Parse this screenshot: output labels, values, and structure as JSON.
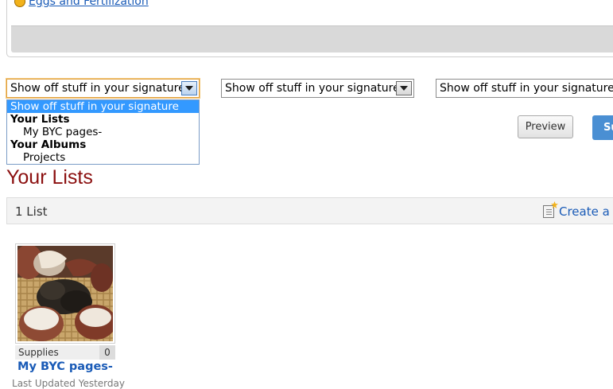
{
  "top_panel": {
    "link_text": " Eggs and Fertilization"
  },
  "signature_selects": [
    {
      "value": "Show off stuff in your signature"
    },
    {
      "value": "Show off stuff in your signature"
    },
    {
      "value": "Show off stuff in your signature"
    }
  ],
  "dropdown": {
    "options": [
      {
        "label": "Show off stuff in your signature"
      },
      {
        "label": "Your Lists"
      },
      {
        "label": "My BYC pages-"
      },
      {
        "label": "Your Albums"
      },
      {
        "label": "Projects"
      }
    ]
  },
  "buttons": {
    "preview": "Preview",
    "submit": "Su"
  },
  "section": {
    "title": "Your Lists"
  },
  "list_bar": {
    "count": "1 List",
    "create_link": "Create a"
  },
  "list_card": {
    "category": "Supplies",
    "count": "0",
    "title": "My BYC pages-",
    "updated": "Last Updated Yesterday"
  },
  "colors": {
    "link": "#1a5bb7",
    "heading": "#8b0f0f",
    "selected_option": "#3399ff",
    "submit_button": "#4a8fd3"
  },
  "icons": [
    "egg-icon",
    "dropdown-arrow-icon",
    "create-list-icon"
  ]
}
